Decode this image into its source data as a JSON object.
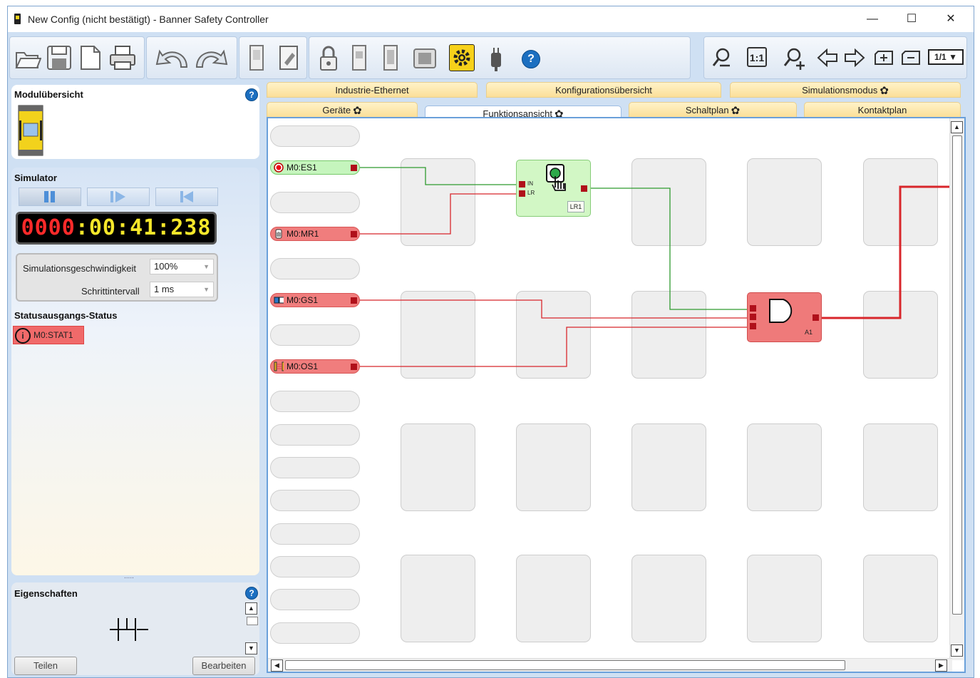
{
  "window": {
    "title": "New Config (nicht bestätigt) - Banner Safety Controller",
    "minimize": "—",
    "maximize": "☐",
    "close": "✕"
  },
  "toolbar": {
    "zoom_1to1": "1:1",
    "page_select": "1/1 ▼"
  },
  "tabs_top": [
    {
      "label": "Industrie-Ethernet"
    },
    {
      "label": "Konfigurationsübersicht"
    },
    {
      "label": "Simulationsmodus"
    }
  ],
  "tabs_bottom": [
    {
      "label": "Geräte"
    },
    {
      "label": "Funktionsansicht"
    },
    {
      "label": "Schaltplan"
    },
    {
      "label": "Kontaktplan"
    }
  ],
  "left": {
    "module_overview_title": "Modulübersicht",
    "simulator_title": "Simulator",
    "clock": {
      "a": "0000",
      "b": "00",
      "c": "41",
      "d": "238",
      "sep": ":"
    },
    "sim_speed_label": "Simulationsgeschwindigkeit",
    "sim_speed_value": "100%",
    "step_interval_label": "Schrittintervall",
    "step_interval_value": "1 ms",
    "status_title": "Statusausgangs-Status",
    "status_item": "M0:STAT1",
    "splitter": ".....",
    "properties_title": "Eigenschaften",
    "share_button": "Teilen",
    "edit_button": "Bearbeiten"
  },
  "diagram": {
    "inputs": [
      {
        "label": "M0:ES1",
        "state": "green"
      },
      {
        "label": "M0:MR1",
        "state": "red"
      },
      {
        "label": "M0:GS1",
        "state": "red"
      },
      {
        "label": "M0:OS1",
        "state": "red"
      }
    ],
    "reset_block": {
      "label": "LR1",
      "pin_in": "IN",
      "pin_lr": "LR"
    },
    "and_block": {
      "label": "A1"
    }
  },
  "colors": {
    "tab_gold": "#fbdf98",
    "wire_green": "#2e9a2e",
    "wire_red": "#d8262b",
    "block_red": "#ef7a7a",
    "block_green": "#d2f7c5",
    "clock_red": "#ff2a2a",
    "clock_yellow": "#f5e72a"
  },
  "icons": [
    "open-folder-icon",
    "save-icon",
    "new-icon",
    "print-icon",
    "undo-icon",
    "redo-icon",
    "module-icon",
    "edit-doc-icon",
    "lock-icon",
    "device-icon",
    "device2-icon",
    "chip-icon",
    "gear-icon",
    "plug-icon",
    "help-icon",
    "zoom-out-icon",
    "zoom-in-icon",
    "arrow-left-icon",
    "arrow-right-icon",
    "add-page-icon",
    "remove-page-icon"
  ]
}
